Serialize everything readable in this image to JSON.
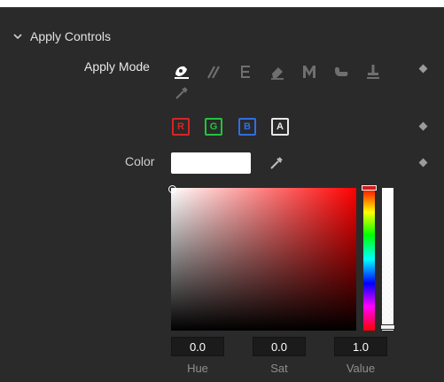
{
  "section": {
    "title": "Apply Controls",
    "expanded": true
  },
  "apply_mode": {
    "label": "Apply Mode",
    "modes": [
      {
        "icon": "color-apply-icon",
        "active": true
      },
      {
        "icon": "clone-brushes-icon",
        "active": false
      },
      {
        "icon": "emboss-icon",
        "active": false
      },
      {
        "icon": "eraser-icon",
        "active": false
      },
      {
        "icon": "merge-icon",
        "active": false
      },
      {
        "icon": "smear-icon",
        "active": false
      },
      {
        "icon": "stamp-icon",
        "active": false
      },
      {
        "icon": "wire-eyedropper-icon",
        "active": false
      }
    ]
  },
  "channels": [
    {
      "label": "R",
      "color": "#d82424"
    },
    {
      "label": "G",
      "color": "#22c43a"
    },
    {
      "label": "B",
      "color": "#2f6fe0"
    },
    {
      "label": "A",
      "color": "#e8e8e8"
    }
  ],
  "color": {
    "label": "Color",
    "swatch_color": "#ffffff",
    "hue": {
      "value": "0.0",
      "label": "Hue"
    },
    "sat": {
      "value": "0.0",
      "label": "Sat"
    },
    "val": {
      "value": "1.0",
      "label": "Value"
    }
  },
  "colors": {
    "panel_bg": "#2a2a2b",
    "text": "#cfcfcf",
    "muted": "#8f8f8f"
  }
}
